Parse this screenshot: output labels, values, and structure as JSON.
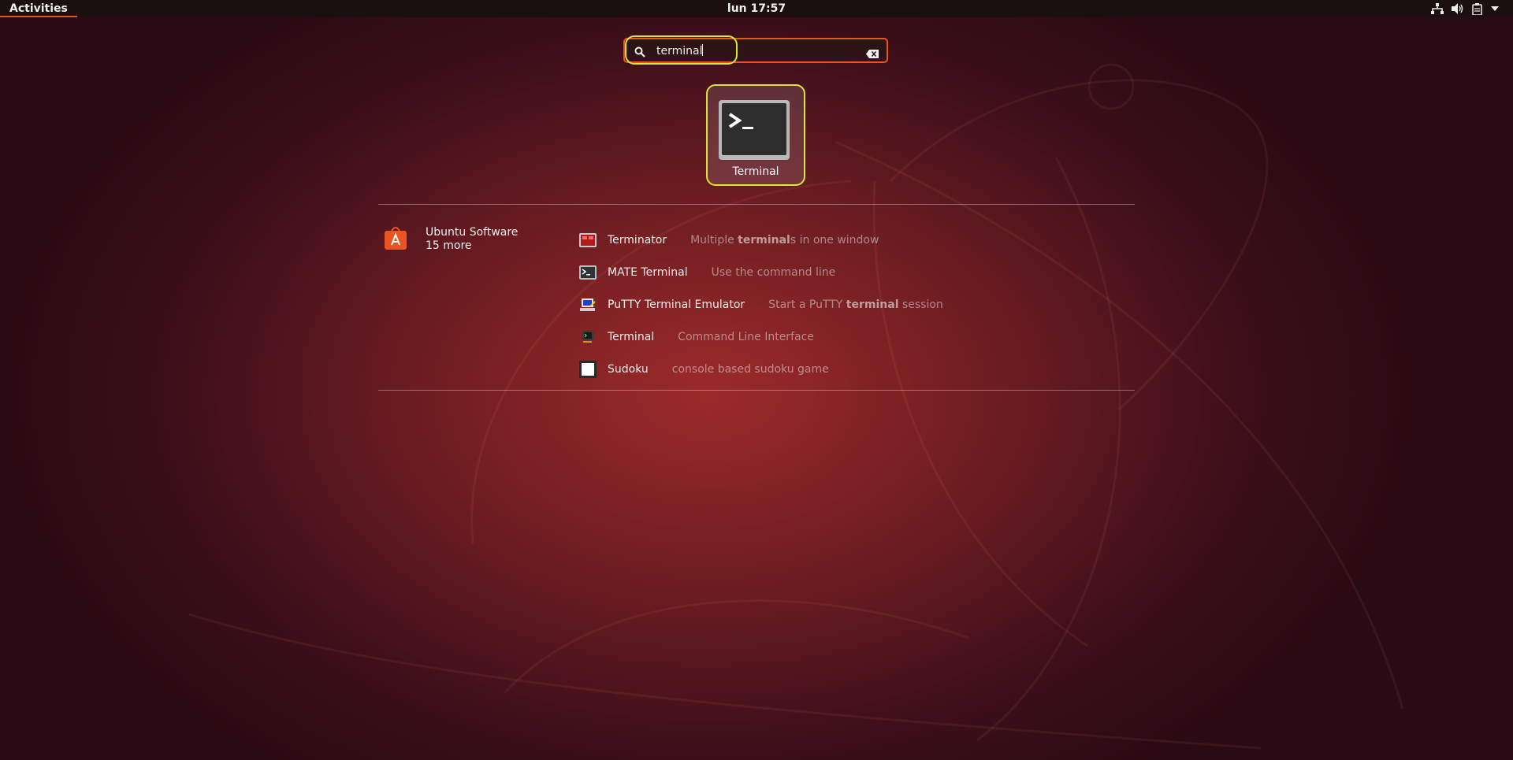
{
  "topbar": {
    "activities_label": "Activities",
    "clock": "lun 17:57",
    "tray_icons": [
      "network-icon",
      "volume-icon",
      "clipboard-icon",
      "system-menu-arrow-icon"
    ]
  },
  "search": {
    "value": "terminal",
    "icons": [
      "search-icon",
      "clear-icon"
    ]
  },
  "top_result": {
    "label": "Terminal",
    "icon": "terminal-icon"
  },
  "provider": {
    "name": "Ubuntu Software",
    "more": "15 more",
    "icon": "ubuntu-software-icon"
  },
  "results": [
    {
      "name": "Terminator",
      "desc_before": "Multiple ",
      "desc_bold": "terminal",
      "desc_after": "s in one window",
      "icon": "terminator-icon"
    },
    {
      "name": "MATE Terminal",
      "desc_before": "Use the command line",
      "desc_bold": "",
      "desc_after": "",
      "icon": "mate-terminal-icon"
    },
    {
      "name": "PuTTY Terminal Emulator",
      "desc_before": "Start a PuTTY ",
      "desc_bold": "terminal",
      "desc_after": " session",
      "icon": "putty-icon"
    },
    {
      "name": "Terminal",
      "desc_before": "Command Line Interface",
      "desc_bold": "",
      "desc_after": "",
      "icon": "terminal-small-icon"
    },
    {
      "name": "Sudoku",
      "desc_before": "console based sudoku game",
      "desc_bold": "",
      "desc_after": "",
      "icon": "sudoku-icon"
    }
  ],
  "colors": {
    "accent": "#e95420",
    "highlight": "#d8e838",
    "topbar_bg": "#1b0f10"
  }
}
